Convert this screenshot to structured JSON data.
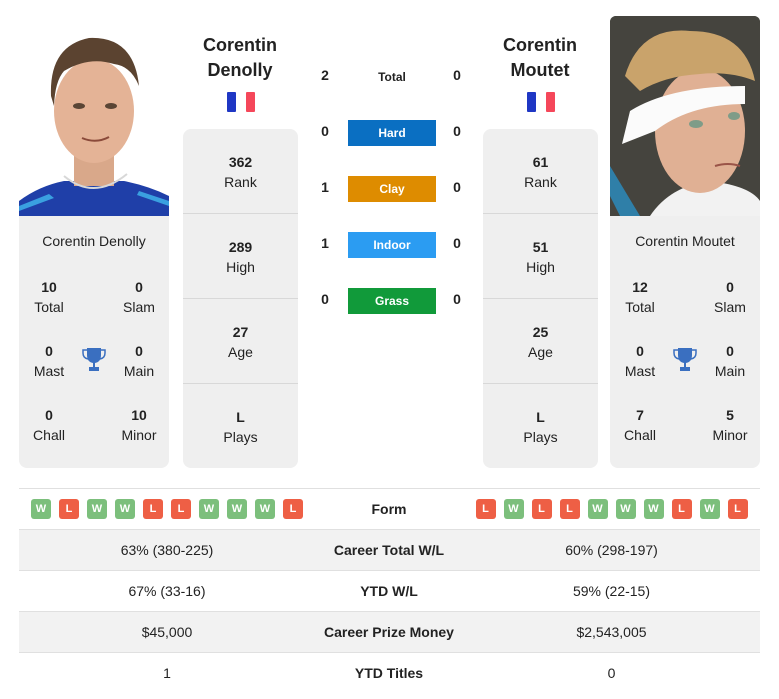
{
  "players": {
    "left": {
      "name": "Corentin Denolly",
      "name_line1": "Corentin",
      "name_line2": "Denolly",
      "country": "France",
      "flag_colors": [
        "#1f37c4",
        "#ffffff",
        "#f5475a"
      ],
      "stats": [
        {
          "value": "362",
          "label": "Rank"
        },
        {
          "value": "289",
          "label": "High"
        },
        {
          "value": "27",
          "label": "Age"
        },
        {
          "value": "L",
          "label": "Plays"
        }
      ],
      "titles": {
        "total": {
          "value": "10",
          "label": "Total"
        },
        "slam": {
          "value": "0",
          "label": "Slam"
        },
        "mast": {
          "value": "0",
          "label": "Mast"
        },
        "main": {
          "value": "0",
          "label": "Main"
        },
        "chall": {
          "value": "0",
          "label": "Chall"
        },
        "minor": {
          "value": "10",
          "label": "Minor"
        }
      },
      "form": [
        "W",
        "L",
        "W",
        "W",
        "L",
        "L",
        "W",
        "W",
        "W",
        "L"
      ]
    },
    "right": {
      "name": "Corentin Moutet",
      "name_line1": "Corentin",
      "name_line2": "Moutet",
      "country": "France",
      "flag_colors": [
        "#1f37c4",
        "#ffffff",
        "#f5475a"
      ],
      "stats": [
        {
          "value": "61",
          "label": "Rank"
        },
        {
          "value": "51",
          "label": "High"
        },
        {
          "value": "25",
          "label": "Age"
        },
        {
          "value": "L",
          "label": "Plays"
        }
      ],
      "titles": {
        "total": {
          "value": "12",
          "label": "Total"
        },
        "slam": {
          "value": "0",
          "label": "Slam"
        },
        "mast": {
          "value": "0",
          "label": "Mast"
        },
        "main": {
          "value": "0",
          "label": "Main"
        },
        "chall": {
          "value": "7",
          "label": "Chall"
        },
        "minor": {
          "value": "5",
          "label": "Minor"
        }
      },
      "form": [
        "L",
        "W",
        "L",
        "L",
        "W",
        "W",
        "W",
        "L",
        "W",
        "L"
      ]
    }
  },
  "h2h": [
    {
      "label": "Total",
      "left": "2",
      "right": "0",
      "color": null
    },
    {
      "label": "Hard",
      "left": "0",
      "right": "0",
      "color": "#0a6fc2"
    },
    {
      "label": "Clay",
      "left": "1",
      "right": "0",
      "color": "#de8c00"
    },
    {
      "label": "Indoor",
      "left": "1",
      "right": "0",
      "color": "#2b9cf2"
    },
    {
      "label": "Grass",
      "left": "0",
      "right": "0",
      "color": "#119a3a"
    }
  ],
  "table": {
    "form_label": "Form",
    "rows": [
      {
        "label": "Career Total W/L",
        "left": "63% (380-225)",
        "right": "60% (298-197)"
      },
      {
        "label": "YTD W/L",
        "left": "67% (33-16)",
        "right": "59% (22-15)"
      },
      {
        "label": "Career Prize Money",
        "left": "$45,000",
        "right": "$2,543,005"
      },
      {
        "label": "YTD Titles",
        "left": "1",
        "right": "0"
      }
    ]
  },
  "icons": {
    "trophy": "trophy-icon",
    "flag": "flag-france-icon"
  },
  "colors": {
    "win": "#7cbf7c",
    "loss": "#ee5f45",
    "trophy": "#3a6fc0",
    "card_bg": "#efefef"
  }
}
